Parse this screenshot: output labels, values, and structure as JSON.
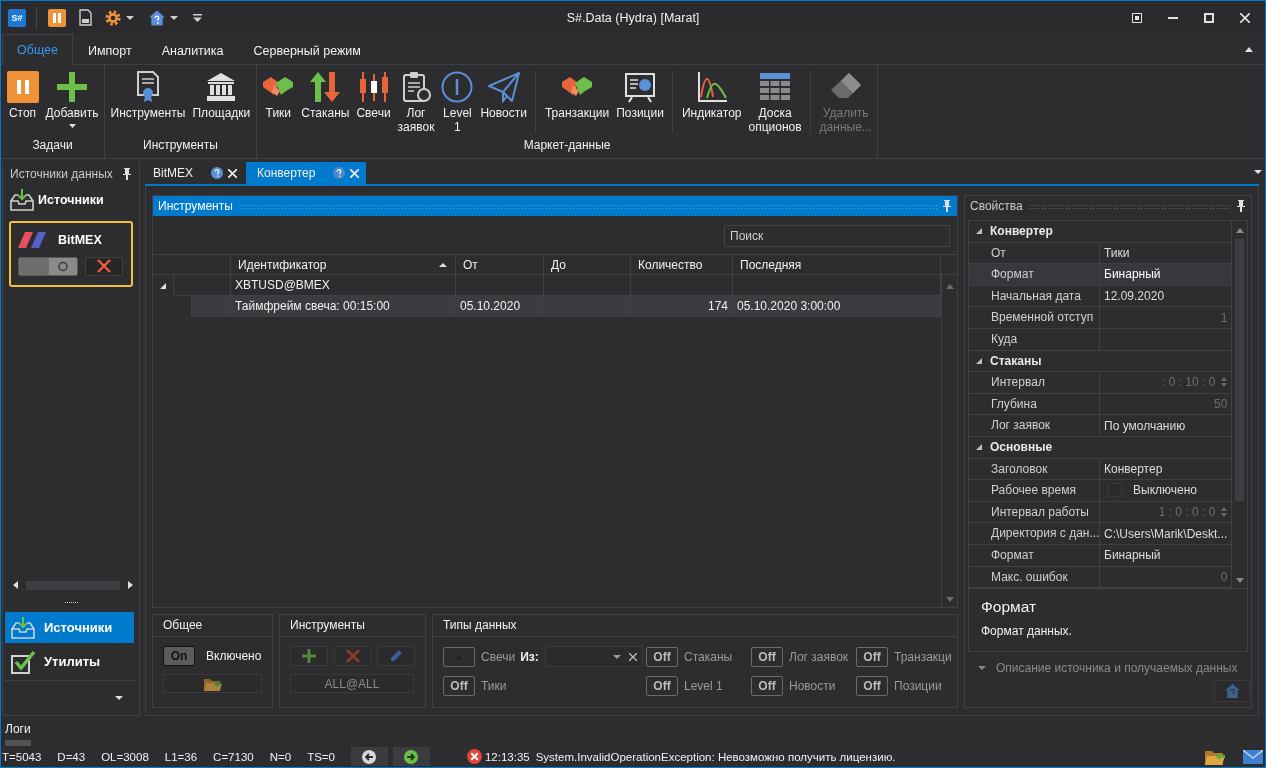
{
  "window": {
    "logo": "S#",
    "title": "S#.Data (Hydra) [Marat]"
  },
  "ribbon": {
    "tabs": [
      {
        "label": "Общее",
        "selected": true
      },
      {
        "label": "Импорт",
        "selected": false
      },
      {
        "label": "Аналитика",
        "selected": false
      },
      {
        "label": "Серверный режим",
        "selected": false
      }
    ],
    "groups": [
      {
        "label": "Задачи",
        "sections": [
          {
            "buttons": [
              {
                "label": "Стоп",
                "disabled": false,
                "dropdown": false
              },
              {
                "label": "Добавить",
                "disabled": false,
                "dropdown": true
              }
            ]
          }
        ]
      },
      {
        "label": "Инструменты",
        "sections": [
          {
            "buttons": [
              {
                "label": "Инструменты",
                "disabled": false,
                "dropdown": false
              },
              {
                "label": "Площадки",
                "disabled": false,
                "dropdown": false
              }
            ]
          }
        ]
      },
      {
        "label": "Маркет-данные",
        "sections": [
          {
            "buttons": [
              {
                "label": "Тики",
                "disabled": false,
                "dropdown": false
              },
              {
                "label": "Стаканы",
                "disabled": false,
                "dropdown": false
              },
              {
                "label": "Свечи",
                "disabled": false,
                "dropdown": false
              },
              {
                "label": "Лог заявок",
                "disabled": false,
                "dropdown": false
              },
              {
                "label": "Level 1",
                "disabled": false,
                "dropdown": false
              },
              {
                "label": "Новости",
                "disabled": false,
                "dropdown": false
              }
            ]
          },
          {
            "buttons": [
              {
                "label": "Транзакции",
                "disabled": false,
                "dropdown": false
              },
              {
                "label": "Позиции",
                "disabled": false,
                "dropdown": false
              }
            ]
          },
          {
            "buttons": [
              {
                "label": "Индикатор",
                "disabled": false,
                "dropdown": false
              },
              {
                "label": "Доска опционов",
                "disabled": false,
                "dropdown": false
              }
            ]
          },
          {
            "buttons": [
              {
                "label": "Удалить данные...",
                "disabled": true,
                "dropdown": false
              }
            ]
          }
        ]
      }
    ]
  },
  "sources_panel": {
    "title": "Источники данных",
    "heading": "Источники",
    "sources": [
      {
        "name": "BitMEX",
        "selected": true
      }
    ],
    "nav": [
      {
        "label": "Источники",
        "selected": true
      },
      {
        "label": "Утилиты",
        "selected": false
      }
    ]
  },
  "document_tabs": [
    {
      "label": "BitMEX",
      "selected": false
    },
    {
      "label": "Конвертер",
      "selected": true
    }
  ],
  "instruments": {
    "title": "Инструменты",
    "search": {
      "placeholder": "Поиск"
    },
    "columns": [
      {
        "label": "Идентификатор",
        "sorted": true
      },
      {
        "label": "От",
        "sorted": false
      },
      {
        "label": "До",
        "sorted": false
      },
      {
        "label": "Количество",
        "sorted": false
      },
      {
        "label": "Последняя",
        "sorted": false
      }
    ],
    "rows": [
      {
        "identifier": "XBTUSD@BMEX",
        "expanded": true,
        "selected": false,
        "children": [
          {
            "identifier": "Таймфрейм свеча: 00:15:00",
            "from": "05.10.2020",
            "quantity": "174",
            "last": "05.10.2020 3:00:00",
            "selected": true
          }
        ]
      }
    ]
  },
  "general": {
    "title": "Общее",
    "toggle": {
      "text": "On",
      "on": true
    },
    "label": "Включено"
  },
  "instrument_filter": {
    "title": "Инструменты",
    "filter": "ALL@ALL"
  },
  "data_types": {
    "title": "Типы данных",
    "items": [
      {
        "label": "Свечи",
        "from_label": "Из:",
        "toggle": {
          "on": false
        }
      },
      {
        "label": "Стаканы",
        "toggle": {
          "text": "Off",
          "on": false
        }
      },
      {
        "label": "Лог заявок",
        "toggle": {
          "text": "Off",
          "on": false
        }
      },
      {
        "label": "Транзакци",
        "toggle": {
          "text": "Off",
          "on": false
        }
      },
      {
        "label": "Тики",
        "toggle": {
          "text": "Off",
          "on": false
        }
      },
      {
        "label": "Level 1",
        "toggle": {
          "text": "Off",
          "on": false
        }
      },
      {
        "label": "Новости",
        "toggle": {
          "text": "Off",
          "on": false
        }
      },
      {
        "label": "Позиции",
        "toggle": {
          "text": "Off",
          "on": false
        }
      }
    ]
  },
  "properties": {
    "title": "Свойства",
    "categories": [
      {
        "label": "Конвертер",
        "expanded": true,
        "items": [
          {
            "name": "От",
            "value": "Тики",
            "kind": "text",
            "selected": false
          },
          {
            "name": "Формат",
            "value": "Бинарный",
            "kind": "text",
            "selected": true
          },
          {
            "name": "Начальная дата",
            "value": "12.09.2020",
            "kind": "text",
            "selected": false
          },
          {
            "name": "Временной отступ",
            "value": "1",
            "kind": "number",
            "selected": false
          },
          {
            "name": "Куда",
            "kind": "text",
            "selected": false
          }
        ]
      },
      {
        "label": "Стаканы",
        "expanded": true,
        "items": [
          {
            "name": "Интервал",
            "value": ": 0 : 10 : 0",
            "kind": "spin",
            "selected": false
          },
          {
            "name": "Глубина",
            "value": "50",
            "kind": "number",
            "selected": false
          },
          {
            "name": "Лог заявок",
            "value": "По умолчанию",
            "kind": "text",
            "selected": false
          }
        ]
      },
      {
        "label": "Основные",
        "expanded": true,
        "items": [
          {
            "name": "Заголовок",
            "value": "Конвертер",
            "kind": "text",
            "selected": false
          },
          {
            "name": "Рабочее время",
            "value": "Выключено",
            "kind": "check",
            "checked": false,
            "selected": false
          },
          {
            "name": "Интервал работы",
            "value": "1 : 0 : 0 : 0",
            "kind": "spin",
            "selected": false
          },
          {
            "name": "Директория с дан...",
            "value": "C:\\Users\\Marik\\Deskt...",
            "kind": "text",
            "selected": false
          },
          {
            "name": "Формат",
            "value": "Бинарный",
            "kind": "text",
            "selected": false
          },
          {
            "name": "Макс. ошибок",
            "value": "0",
            "kind": "number",
            "selected": false
          }
        ]
      }
    ],
    "description": {
      "title": "Формат",
      "text": "Формат данных."
    },
    "source_info": {
      "label": "Описание источника и получаемых данных",
      "expanded": false
    }
  },
  "status_bar": {
    "logs_title": "Логи",
    "counters": [
      "T=5043",
      "D=43",
      "OL=3008",
      "L1=36",
      "C=7130",
      "N=0",
      "TS=0"
    ],
    "message": {
      "kind": "error",
      "time": "12:13:35",
      "text": "System.InvalidOperationException: Невозможно получить лицензию."
    }
  }
}
